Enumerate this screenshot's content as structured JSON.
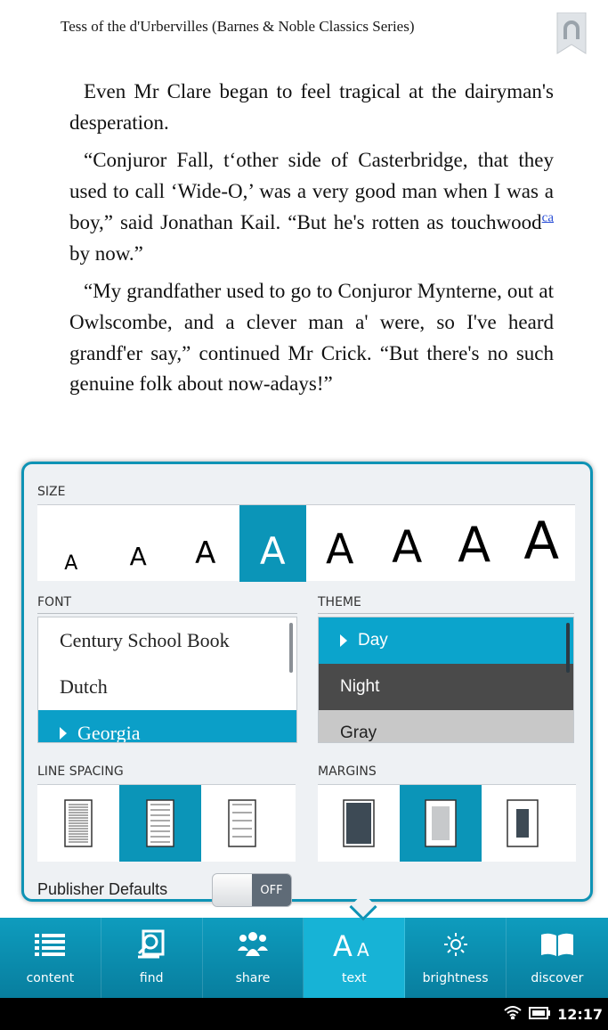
{
  "book": {
    "title": "Tess of the d'Urbervilles (Barnes & Noble Classics Series)",
    "bookmark_icon": "bookmark-icon"
  },
  "reader": {
    "p1": "Even Mr Clare began to feel tragical at the dairyman's desperation.",
    "p2_before": "“Conjuror Fall, t‘other side of Casterbridge, that they used to call ‘Wide-O,’ was a very good man when I was a boy,” said Jonathan Kail. “But he's rotten as touchwood",
    "p2_footnote": "ca",
    "p2_after": " by now.”",
    "p3": "“My grandfather used to go to Conjuror Mynterne, out at Owlscombe, and a clever man a' were, so I've heard grandf'er say,” continued Mr Crick. “But there's no such genuine folk about now-adays!”"
  },
  "panel": {
    "size_label": "SIZE",
    "size_options": [
      "A",
      "A",
      "A",
      "A",
      "A",
      "A",
      "A",
      "A"
    ],
    "size_selected_index": 3,
    "font_label": "FONT",
    "fonts": [
      "Century School Book",
      "Dutch",
      "Georgia"
    ],
    "font_selected": "Georgia",
    "theme_label": "THEME",
    "themes": [
      "Day",
      "Night",
      "Gray"
    ],
    "theme_selected": "Day",
    "line_spacing_label": "LINE SPACING",
    "line_spacing_selected_index": 1,
    "margins_label": "MARGINS",
    "margins_selected_index": 1,
    "publisher_defaults_label": "Publisher Defaults",
    "publisher_defaults_state": "OFF"
  },
  "toolbar": {
    "items": [
      {
        "label": "content",
        "icon": "list-icon"
      },
      {
        "label": "find",
        "icon": "find-icon"
      },
      {
        "label": "share",
        "icon": "people-icon"
      },
      {
        "label": "text",
        "icon": "text-size-icon"
      },
      {
        "label": "brightness",
        "icon": "brightness-icon"
      },
      {
        "label": "discover",
        "icon": "open-book-icon"
      }
    ],
    "active": "text"
  },
  "status": {
    "time": "12:17"
  },
  "colors": {
    "accent": "#0b95b8",
    "toolbar": "#0e9cbe",
    "night": "#4a4a4a",
    "gray": "#c8c8c8"
  }
}
